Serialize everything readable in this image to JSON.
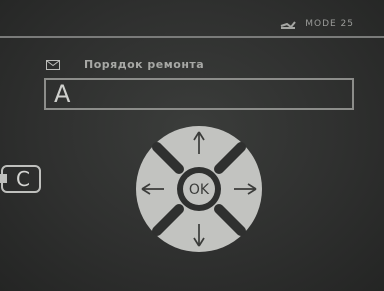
{
  "header": {
    "mode_text": "MODE 25",
    "mode_icon": "wrench-icon"
  },
  "form": {
    "title": "Порядок ремонта",
    "title_icon": "envelope-icon",
    "input_value": "A"
  },
  "controls": {
    "back_label": "C",
    "ok_label": "OK",
    "arrows": [
      "up",
      "right",
      "down",
      "left"
    ]
  },
  "colors": {
    "background": "#2f302f",
    "line": "#7a7b7a",
    "dpad_fill": "#c2c3c0",
    "text": "#a7a8a5"
  }
}
